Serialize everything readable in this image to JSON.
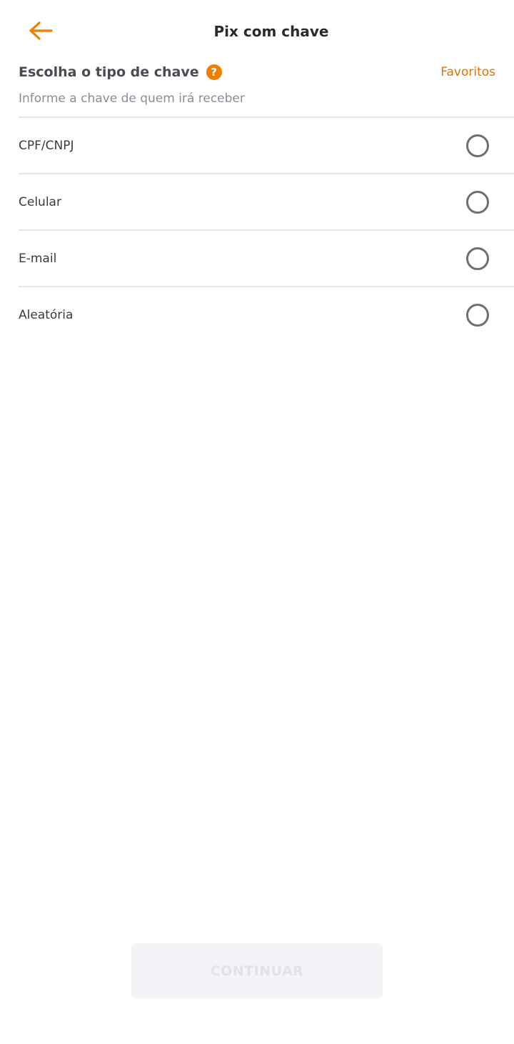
{
  "header": {
    "title": "Pix com chave",
    "back_icon": "arrow-left-icon"
  },
  "section": {
    "title": "Escolha o tipo de chave",
    "help_icon_glyph": "?",
    "favorites_label": "Favoritos",
    "subtitle": "Informe a chave de quem irá receber"
  },
  "options": [
    {
      "label": "CPF/CNPJ",
      "selected": false
    },
    {
      "label": "Celular",
      "selected": false
    },
    {
      "label": "E-mail",
      "selected": false
    },
    {
      "label": "Aleatória",
      "selected": false
    }
  ],
  "footer": {
    "continue_label": "CONTINUAR",
    "continue_enabled": false
  },
  "colors": {
    "accent": "#ef7d00",
    "title_text": "#2a2a2a",
    "muted_text": "#8b8c95",
    "divider": "#e7e7ea",
    "disabled_button_bg": "#f3f4f7"
  }
}
